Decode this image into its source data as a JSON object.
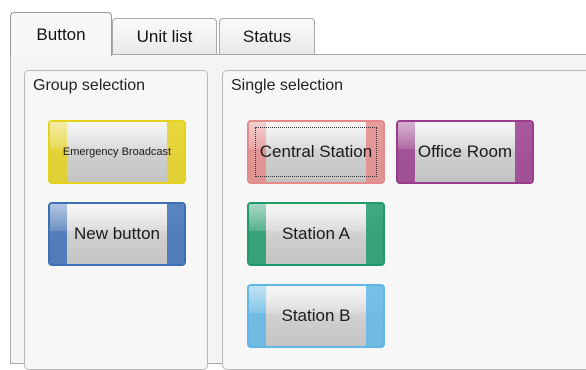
{
  "tabs": [
    {
      "label": "Button",
      "active": true
    },
    {
      "label": "Unit list",
      "active": false
    },
    {
      "label": "Status",
      "active": false
    }
  ],
  "group_selection": {
    "title": "Group selection",
    "buttons": [
      {
        "label": "Emergency Broadcast",
        "color": "#e6d21c"
      },
      {
        "label": "New button",
        "color": "#3c6fb5"
      }
    ]
  },
  "single_selection": {
    "title": "Single selection",
    "buttons": [
      {
        "label": "Central Station",
        "color": "#e38a8a",
        "focused": true
      },
      {
        "label": "Office Room",
        "color": "#9a3c8c"
      },
      {
        "label": "Station A",
        "color": "#1f9a6a"
      },
      {
        "label": "Station B",
        "color": "#5fb7e5"
      }
    ]
  }
}
